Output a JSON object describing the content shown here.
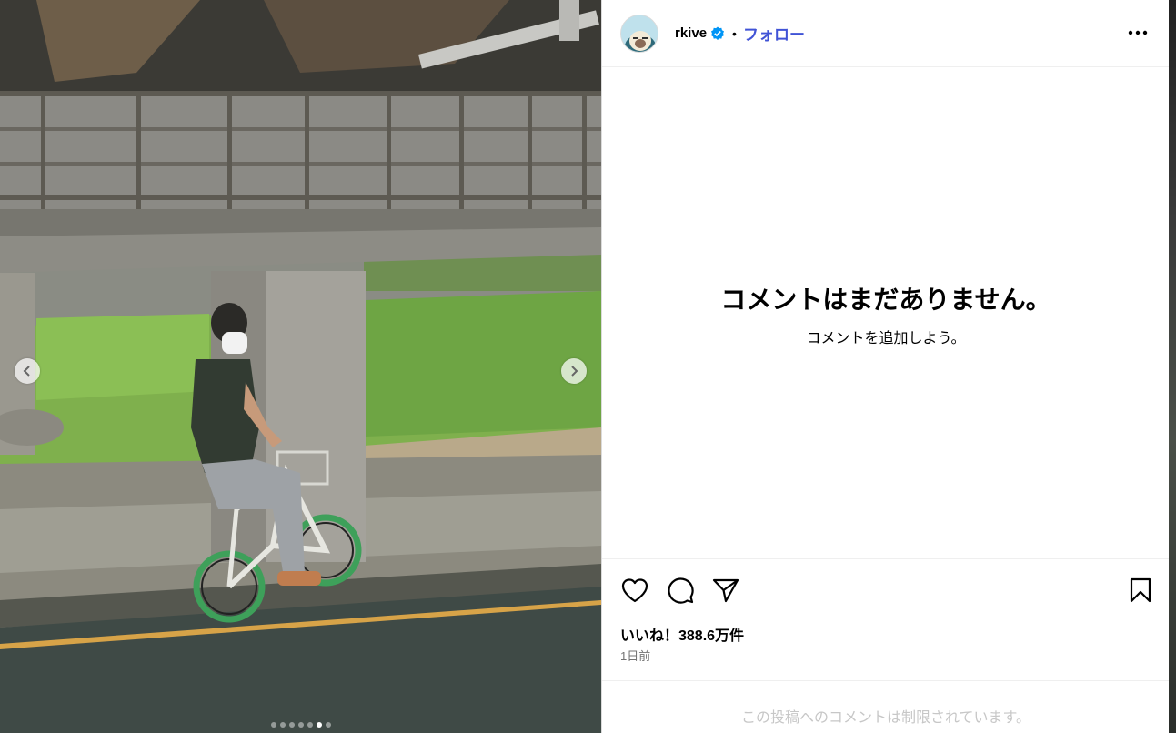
{
  "post": {
    "username": "rkive",
    "separator": "•",
    "follow_label": "フォロー",
    "verified_icon": "verified-badge-icon",
    "more_icon": "more-options-icon"
  },
  "comments": {
    "empty_title": "コメントはまだありません。",
    "empty_subtitle": "コメントを追加しよう。"
  },
  "actions": {
    "icons": [
      "heart-icon",
      "comment-icon",
      "share-icon",
      "bookmark-icon"
    ],
    "likes_text": "いいね！388.6万件",
    "time_text": "1日前"
  },
  "footer": {
    "restricted_text": "この投稿へのコメントは制限されています。"
  },
  "carousel": {
    "total_slides": 7,
    "active_index": 5,
    "prev_icon": "chevron-left-icon",
    "next_icon": "chevron-right-icon"
  },
  "colors": {
    "follow": "#4053d6",
    "verified": "#0095f6",
    "muted": "#737373",
    "placeholder": "#c7c7c7"
  }
}
